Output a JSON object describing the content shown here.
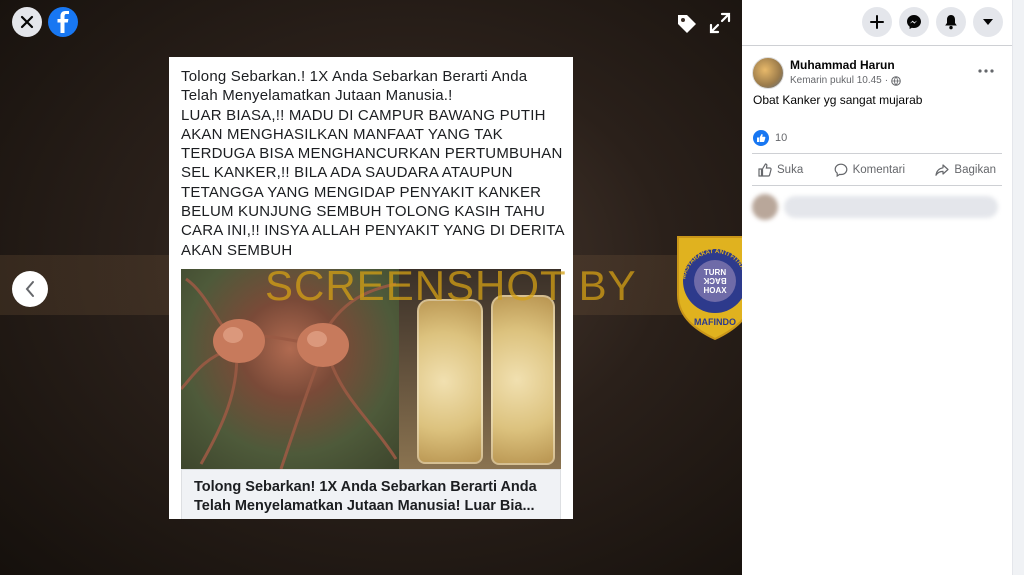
{
  "viewer": {
    "post_text": "Tolong Sebarkan.! 1X Anda Sebarkan Berarti Anda\nTelah Menyelamatkan Jutaan Manusia.!\nLUAR BIASA,!! MADU DI CAMPUR BAWANG PUTIH\nAKAN MENGHASILKAN MANFAAT YANG TAK\nTERDUGA BISA MENGHANCURKAN PERTUMBUHAN\nSEL KANKER,!! BILA ADA SAUDARA ATAUPUN\nTETANGGA YANG MENGIDAP PENYAKIT KANKER\nBELUM KUNJUNG SEMBUH TOLONG KASIH TAHU\nCARA INI,!! INSYA ALLAH PENYAKIT YANG DI DERITA\nAKAN SEMBUH",
    "link_title": "Tolong Sebarkan! 1X Anda Sebarkan Berarti Anda Telah Menyelamatkan Jutaan Manusia! Luar Bia...",
    "watermark": "SCREENSHOT BY",
    "badge": {
      "ring_text": "MASYARAKAT ANTI FITNAH INDONESIA",
      "center_line1": "TURN",
      "center_line2": "BACK",
      "center_line3": "HOAX",
      "bottom_text": "MAFINDO"
    }
  },
  "post": {
    "author": "Muhammad Harun",
    "time": "Kemarin pukul 10.45",
    "privacy_icon": "globe-icon",
    "caption": "Obat Kanker yg sangat mujarab",
    "like_count": "10"
  },
  "actions": {
    "like": "Suka",
    "comment": "Komentari",
    "share": "Bagikan"
  },
  "colors": {
    "brand": "#1877f2",
    "badge_gold": "#e0b21f",
    "badge_blue": "#2d3a8c",
    "watermark": "#d4a014"
  }
}
